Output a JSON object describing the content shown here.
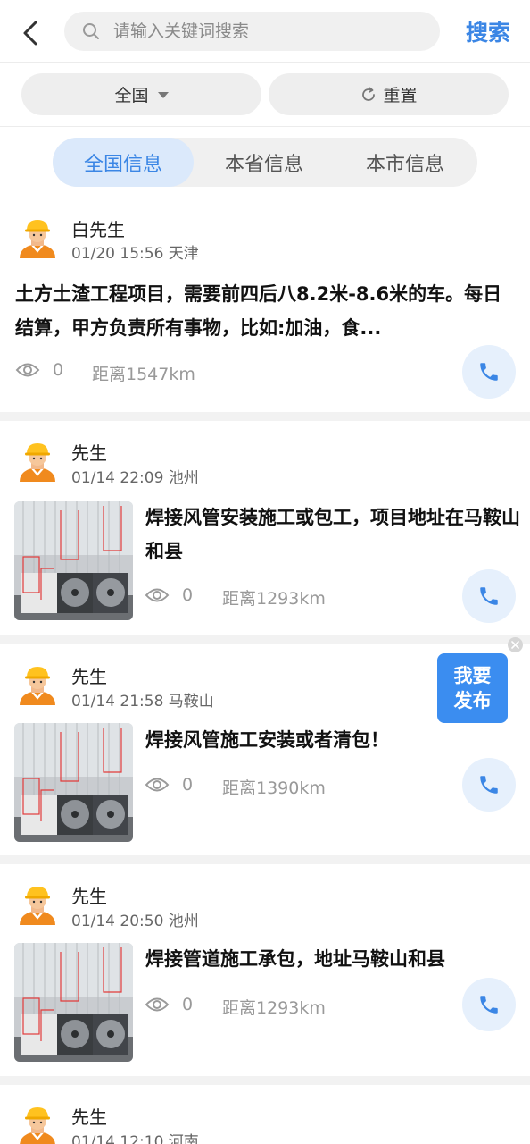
{
  "search": {
    "placeholder": "请输入关键词搜索",
    "value": "",
    "button_label": "搜索"
  },
  "filters": {
    "region_label": "全国",
    "reset_label": "重置"
  },
  "tabs": [
    {
      "label": "全国信息",
      "active": true
    },
    {
      "label": "本省信息",
      "active": false
    },
    {
      "label": "本市信息",
      "active": false
    }
  ],
  "posts": [
    {
      "name": "白先生",
      "meta": "01/20 15:56 天津",
      "title": "土方土渣工程项目，需要前四后八8.2米-8.6米的车。每日结算，甲方负责所有事物，比如:加油，食...",
      "views": "0",
      "distance": "距离1547km",
      "has_image": false
    },
    {
      "name": "先生",
      "meta": "01/14 22:09 池州",
      "title": "焊接风管安装施工或包工，项目地址在马鞍山和县",
      "views": "0",
      "distance": "距离1293km",
      "has_image": true
    },
    {
      "name": "先生",
      "meta": "01/14 21:58 马鞍山",
      "title": "焊接风管施工安装或者清包！",
      "views": "0",
      "distance": "距离1390km",
      "has_image": true
    },
    {
      "name": "先生",
      "meta": "01/14 20:50 池州",
      "title": "焊接管道施工承包，地址马鞍山和县",
      "views": "0",
      "distance": "距离1293km",
      "has_image": true
    },
    {
      "name": "先生",
      "meta": "01/14 12:10 河南",
      "has_image": true
    }
  ],
  "float_button": {
    "line1": "我要",
    "line2": "发布"
  },
  "icons": {
    "back": "chevron-left-icon",
    "search": "search-icon",
    "caret": "caret-down-icon",
    "reset": "refresh-icon",
    "eye": "eye-icon",
    "phone": "phone-icon",
    "close": "close-icon"
  },
  "colors": {
    "accent": "#3b86e5",
    "tab_active_bg": "#dbe9fb",
    "float_bg": "#3b8df0"
  }
}
